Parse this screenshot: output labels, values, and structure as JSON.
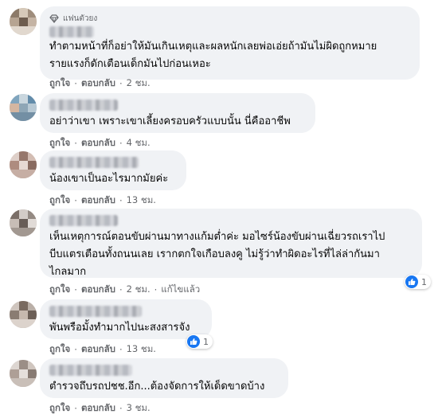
{
  "comments": [
    {
      "badge": "แฟนตัวยง",
      "text": "ทำตามหน้าที่ก็อย่าให้มันเกินเหตุและผลหนักเลยพ่อเอ่ยถ้ามันไม่ผิดถูกหมาย\nรายแรงก็ดักเตือนเด็กมันไปก่อนเหอะ",
      "like": "ถูกใจ",
      "reply": "ตอบกลับ",
      "time": "2 ชม."
    },
    {
      "text": "อย่าว่าเขา เพราะเขาเลี้ยงครอบครัวแบบนั้น นี่คืออาชีพ",
      "like": "ถูกใจ",
      "reply": "ตอบกลับ",
      "time": "4 ชม."
    },
    {
      "text": "น้องเขาเป็นอะไรมากมัยค่ะ",
      "like": "ถูกใจ",
      "reply": "ตอบกลับ",
      "time": "13 ชม."
    },
    {
      "text": "เห็นเหตุการณ์ตอนขับผ่านมาทางแก้มต่ำค่ะ มอไซร์น้องขับผ่านเฉี่ยวรถเราไป\nบีบแตรเตือนทั้งถนนเลย เรากตกใจเกือบลงคู ไม่รู้ว่าทำผิดอะไรที่ไล่ล่ากันมา\nไกลมาก",
      "like": "ถูกใจ",
      "reply": "ตอบกลับ",
      "time": "2 ชม.",
      "edited": "แก้ไขแล้ว",
      "reaction_count": "1"
    },
    {
      "text": "พันพรือมั้งทำมากไปนะสงสารจัง",
      "like": "ถูกใจ",
      "reply": "ตอบกลับ",
      "time": "13 ชม.",
      "reaction_count": "1"
    },
    {
      "text": "ตำรวจถึบรถปชช.อีก...ต้องจัดการให้เด็ดขาดบ้าง",
      "like": "ถูกใจ",
      "reply": "ตอบกลับ",
      "time": "3 ชม."
    }
  ],
  "dot": "·",
  "icons": {
    "badge": "diamond-icon",
    "reaction": "like-icon"
  },
  "colors": {
    "bubble": "#f0f2f5",
    "meta": "#65676b",
    "like": "#1877f2"
  }
}
